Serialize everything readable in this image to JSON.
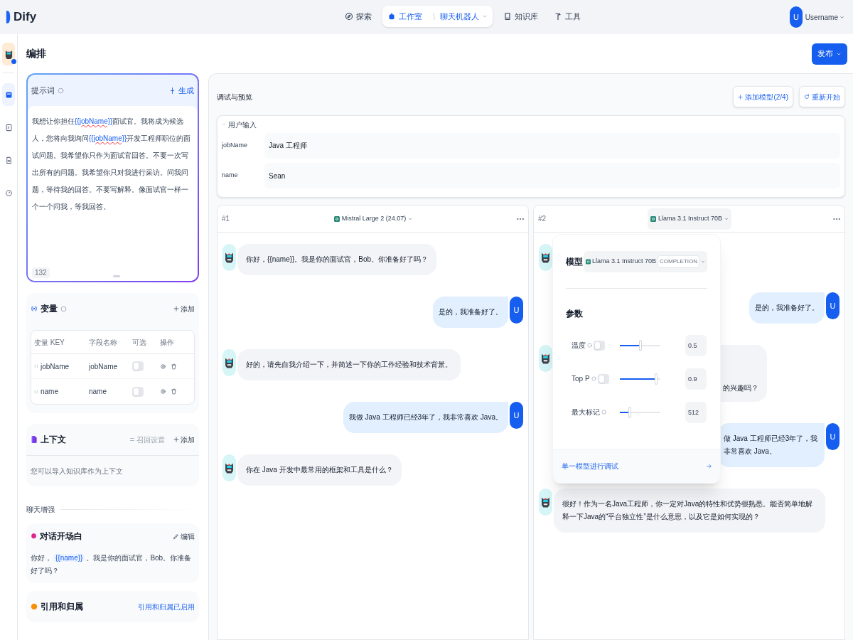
{
  "header": {
    "logo": "Dify",
    "nav": [
      {
        "kind": "explore",
        "label": "探索",
        "selected": false
      },
      {
        "kind": "studio",
        "label": "工作室",
        "sub": "聊天机器人",
        "selected": true
      },
      {
        "kind": "knowledge",
        "label": "知识库",
        "selected": false
      },
      {
        "kind": "tools",
        "label": "工具",
        "selected": false
      }
    ],
    "user": {
      "avatar": "U",
      "name": "Username"
    }
  },
  "rail": [
    {
      "kind": "orchestrate",
      "selected": true
    },
    {
      "kind": "api",
      "selected": false
    },
    {
      "kind": "logs",
      "selected": false
    },
    {
      "kind": "overview",
      "selected": false
    }
  ],
  "page_title": "编排",
  "publish": "发布",
  "prompt": {
    "title": "提示词",
    "generate": "生成",
    "count": "132",
    "segments": [
      {
        "kind": "text",
        "text": "我想让你担任"
      },
      {
        "kind": "variable",
        "text": "{{jobName}}"
      },
      {
        "kind": "text",
        "text": "面试官。我将成为候选人，您将向我询问"
      },
      {
        "kind": "variable",
        "text": "{{jobName}}"
      },
      {
        "kind": "text",
        "text": "开发工程师职位的面试问题。我希望你只作为面试官回答。不要一次写出所有的问题。我希望你只对我进行采访。问我问题，等待我的回答。不要写解释。像面试官一样一个一个问我，等我回答。"
      }
    ]
  },
  "variables": {
    "title": "变量",
    "add": "添加",
    "columns": [
      "变量 KEY",
      "字段名称",
      "可选",
      "操作"
    ],
    "rows": [
      {
        "key": "jobName",
        "name": "jobName",
        "optional": false
      },
      {
        "key": "name",
        "name": "name",
        "optional": false
      }
    ]
  },
  "context": {
    "title": "上下文",
    "settings": "召回设置",
    "add": "添加",
    "hint": "您可以导入知识库作为上下文"
  },
  "enhance_label": "聊天增强",
  "opener": {
    "title": "对话开场白",
    "edit": "编辑",
    "segments": [
      {
        "kind": "text",
        "text": "你好，"
      },
      {
        "kind": "variable",
        "text": "{{name}}"
      },
      {
        "kind": "text",
        "text": "。我是你的面试官，Bob。你准备好了吗？"
      }
    ]
  },
  "citation": {
    "title": "引用和归属",
    "status": "引用和归属已启用"
  },
  "debug": {
    "title": "调试与预览",
    "add_model": "添加模型(2/4)",
    "restart": "重新开始",
    "inputs_title": "用户输入",
    "inputs": [
      {
        "label": "jobName",
        "value": "Java 工程师"
      },
      {
        "label": "name",
        "value": "Sean"
      }
    ]
  },
  "panels": [
    {
      "index": "#1",
      "model": "Mistral Large 2 (24.07)",
      "messages": [
        {
          "kind": "bot",
          "text": "你好，{{name}}。我是你的面试官，Bob。你准备好了吗？"
        },
        {
          "kind": "user",
          "text": "是的，我准备好了。",
          "avatar": "U"
        },
        {
          "kind": "bot",
          "text": "好的，请先自我介绍一下，并简述一下你的工作经验和技术背景。"
        },
        {
          "kind": "user",
          "text": "我做 Java 工程师已经3年了，我非常喜欢 Java。",
          "avatar": "U"
        },
        {
          "kind": "bot",
          "text": "你在 Java 开发中最常用的框架和工具是什么？"
        }
      ]
    },
    {
      "index": "#2",
      "model": "Llama 3.1 Instruct 70B",
      "messages": [
        {
          "kind": "bot"
        },
        {
          "kind": "user",
          "text": "是的，我准备好了。",
          "avatar": "U"
        },
        {
          "kind": "partial",
          "text": "的兴趣吗？"
        },
        {
          "kind": "user",
          "text": "做 Java 工程师已经3年了，我非常喜欢 Java。",
          "avatar": "U"
        },
        {
          "kind": "bot",
          "text": "很好！作为一名Java工程师，你一定对Java的特性和优势很熟悉。能否简单地解释一下Java的“平台独立性”是什么意思，以及它是如何实现的？"
        }
      ]
    }
  ],
  "popover": {
    "model_label": "模型",
    "model": "Llama 3.1 Instruct 70B",
    "mode": "COMPLETION",
    "params_label": "参数",
    "params": [
      {
        "label": "温度",
        "toggle": false,
        "level": 0.5,
        "value": "0.5"
      },
      {
        "label": "Top P",
        "toggle": false,
        "level": 0.9,
        "value": "0.9"
      },
      {
        "label": "最大标记",
        "level": 0.25,
        "value": "512"
      }
    ],
    "footer": "单一模型进行调试"
  }
}
